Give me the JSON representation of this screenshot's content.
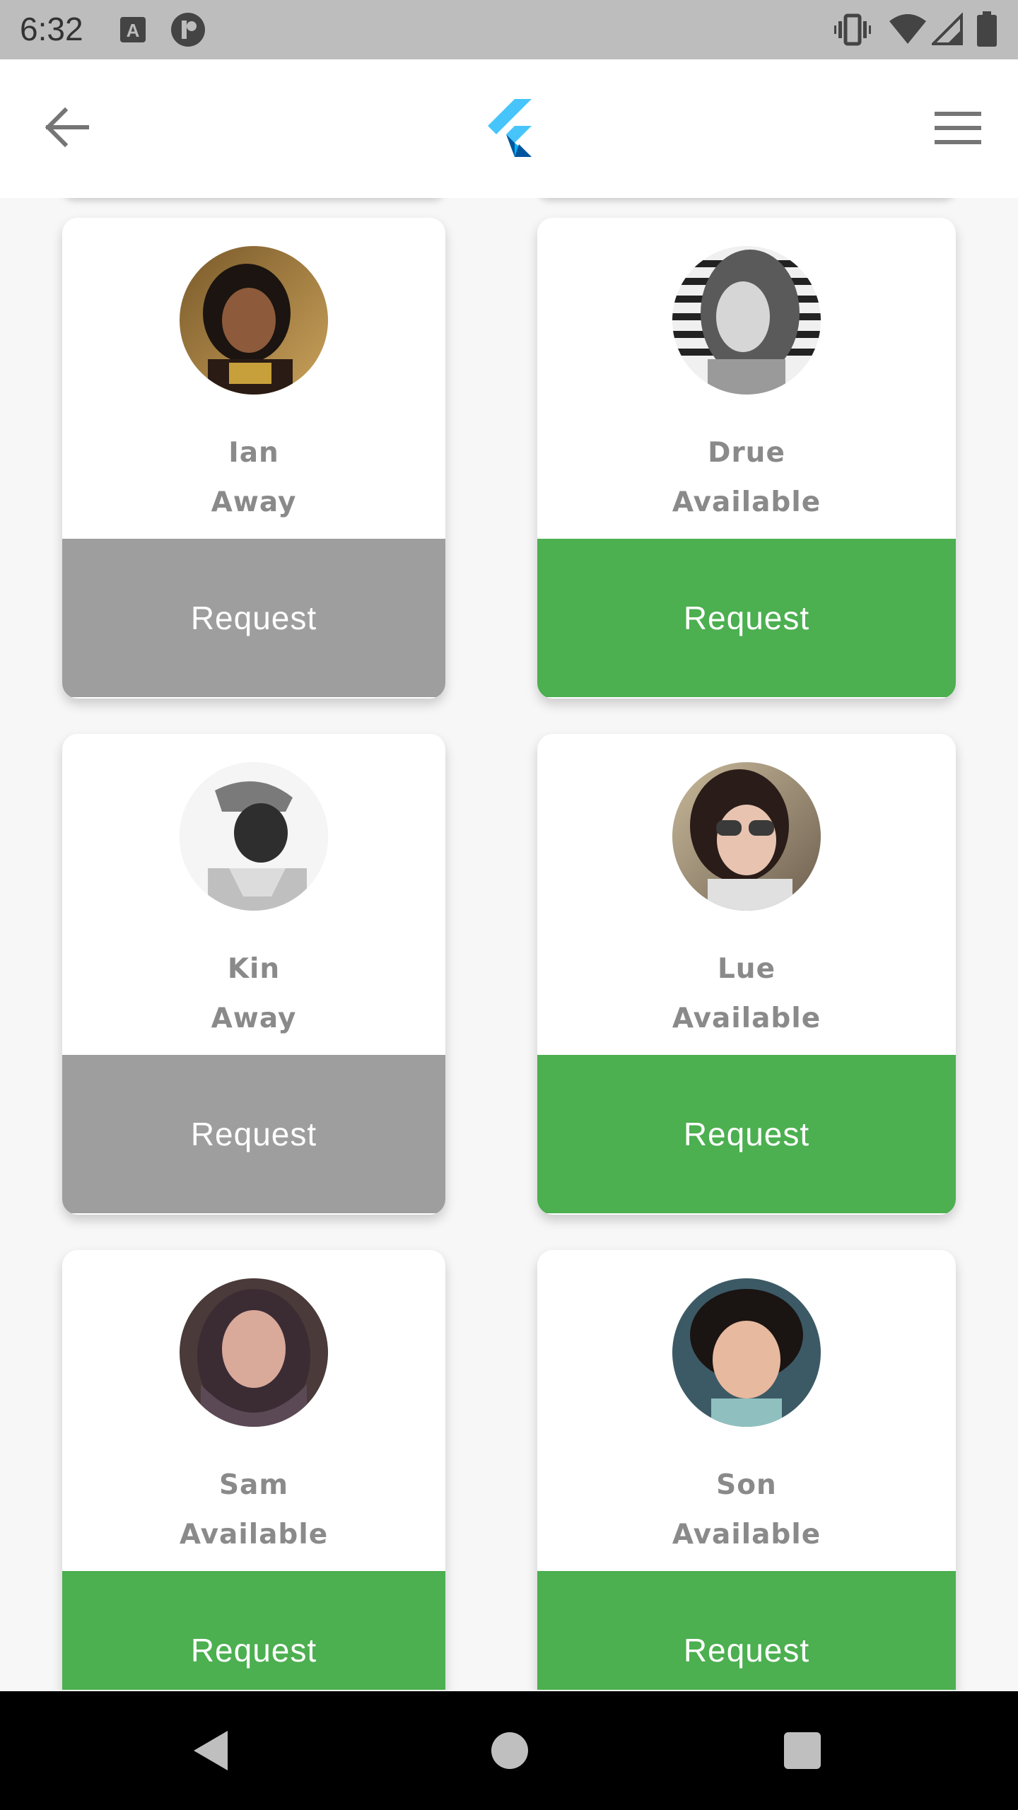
{
  "status_bar": {
    "time": "6:32",
    "icons": [
      "keyboard-a-icon",
      "app-notification-icon",
      "vibrate-icon",
      "wifi-icon",
      "signal-icon",
      "battery-icon"
    ]
  },
  "app_bar": {
    "back_icon": "arrow-left-icon",
    "logo_icon": "flutter-logo-icon",
    "menu_icon": "hamburger-menu-icon"
  },
  "colors": {
    "available": "#4caf50",
    "away": "#9e9e9e",
    "text": "#8a8a8a"
  },
  "contacts": [
    {
      "name": "Ian",
      "status": "Away",
      "button": "Request"
    },
    {
      "name": "Drue",
      "status": "Available",
      "button": "Request"
    },
    {
      "name": "Kin",
      "status": "Away",
      "button": "Request"
    },
    {
      "name": "Lue",
      "status": "Available",
      "button": "Request"
    },
    {
      "name": "Sam",
      "status": "Available",
      "button": "Request"
    },
    {
      "name": "Son",
      "status": "Available",
      "button": "Request"
    }
  ],
  "nav_bar": {
    "icons": [
      "nav-back-icon",
      "nav-home-icon",
      "nav-recents-icon"
    ]
  }
}
